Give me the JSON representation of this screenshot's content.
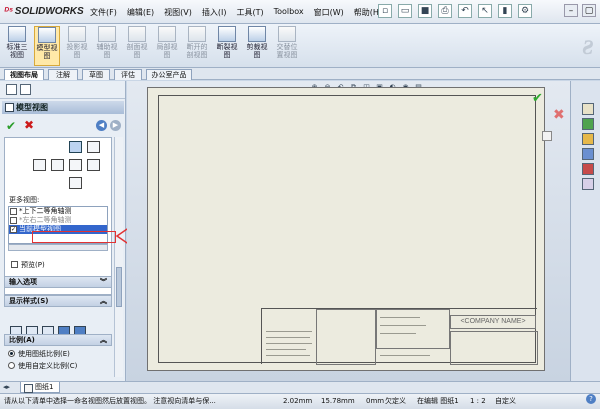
{
  "app": {
    "brand": "SOLIDWORKS",
    "menus": [
      "文件(F)",
      "编辑(E)",
      "视图(V)",
      "插入(I)",
      "工具(T)",
      "Toolbox",
      "窗口(W)",
      "帮助(H)"
    ]
  },
  "ribbon": {
    "buttons": [
      {
        "label": "标准三视图",
        "state": "normal"
      },
      {
        "label": "模型视图",
        "state": "active"
      },
      {
        "label": "投影视图",
        "state": "dim"
      },
      {
        "label": "辅助视图",
        "state": "dim"
      },
      {
        "label": "剖面视图",
        "state": "dim"
      },
      {
        "label": "局部视图",
        "state": "dim"
      },
      {
        "label": "断开的剖视图",
        "state": "dim"
      },
      {
        "label": "断裂视图",
        "state": "normal"
      },
      {
        "label": "剪裁视图",
        "state": "normal"
      },
      {
        "label": "交替位置视图",
        "state": "dim"
      }
    ]
  },
  "tabs": [
    "视图布局",
    "注解",
    "草图",
    "评估",
    "办公室产品"
  ],
  "panel": {
    "title": "模型视图",
    "more_views_label": "更多视图:",
    "list_items": [
      {
        "label": "*上下二等角轴测",
        "checked": false,
        "selected": false
      },
      {
        "label": "*左右二等角轴测",
        "checked": false,
        "selected": false,
        "cut": true
      },
      {
        "label": "当前模型视图",
        "checked": true,
        "selected": true
      }
    ],
    "preview_label": "预览(P)",
    "import_options_label": "输入选项",
    "display_style_label": "显示样式(S)",
    "scale_label": "比例(A)",
    "scale_options": [
      {
        "label": "使用图纸比例(E)",
        "selected": true
      },
      {
        "label": "使用自定义比例(C)",
        "selected": false
      }
    ]
  },
  "drawing": {
    "company_name": "<COMPANY NAME>"
  },
  "sheet_tab": "图纸1",
  "status": {
    "message": "请从以下清单中选择一命名视图然后放置视图。 注意视向清单与保...",
    "x": "2.02mm",
    "y": "15.78mm",
    "z": "0mm",
    "define": "欠定义",
    "mode": "在编辑 图纸1",
    "scale": "1 : 2",
    "custom": "自定义"
  },
  "colors": {
    "brand_red": "#c8102e",
    "selection_blue": "#3366cc",
    "annotation_red": "#e23232"
  }
}
